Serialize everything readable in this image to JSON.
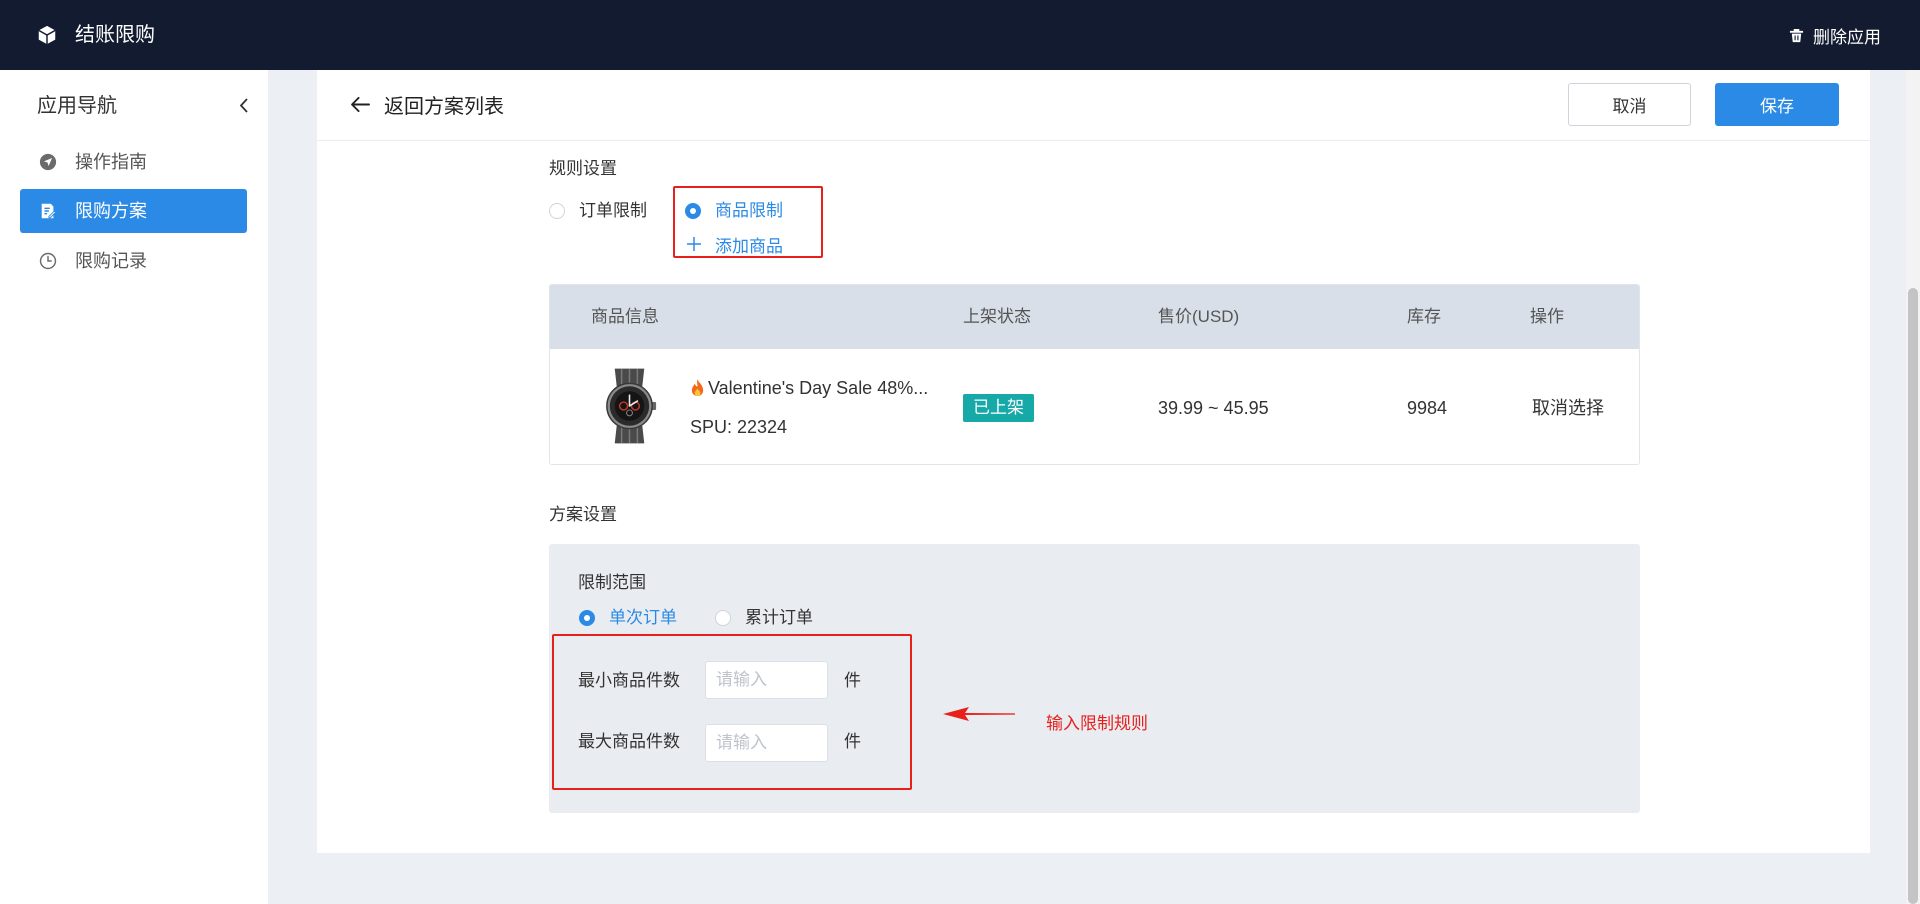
{
  "app": {
    "title": "结账限购",
    "delete_label": "删除应用"
  },
  "sidebar": {
    "heading": "应用导航",
    "items": [
      {
        "label": "操作指南",
        "icon": "navigation-icon",
        "active": false
      },
      {
        "label": "限购方案",
        "icon": "document-edit-icon",
        "active": true
      },
      {
        "label": "限购记录",
        "icon": "clock-icon",
        "active": false
      }
    ]
  },
  "header": {
    "back_label": "返回方案列表",
    "cancel_label": "取消",
    "save_label": "保存"
  },
  "rule_settings": {
    "label": "规则设置",
    "options": [
      {
        "label": "订单限制",
        "selected": false
      },
      {
        "label": "商品限制",
        "selected": true
      }
    ],
    "add_product_label": "添加商品"
  },
  "product_table": {
    "columns": [
      "商品信息",
      "上架状态",
      "售价(USD)",
      "库存",
      "操作"
    ],
    "rows": [
      {
        "title_icon": "fire-icon",
        "title": "Valentine's Day Sale 48%...",
        "spu": "SPU: 22324",
        "status": "已上架",
        "price": "39.99 ~ 45.95",
        "stock": "9984",
        "action": "取消选择"
      }
    ]
  },
  "plan_settings": {
    "label": "方案设置",
    "scope_label": "限制范围",
    "scope_options": [
      {
        "label": "单次订单",
        "selected": true
      },
      {
        "label": "累计订单",
        "selected": false
      }
    ],
    "min_label": "最小商品件数",
    "max_label": "最大商品件数",
    "min_value": "",
    "max_value": "",
    "placeholder": "请输入",
    "unit": "件"
  },
  "annotation": {
    "text": "输入限制规则"
  },
  "colors": {
    "accent": "#2b8ae5",
    "topbar": "#131b30",
    "status_badge": "#17a8a8",
    "annotation": "#e8201c"
  }
}
